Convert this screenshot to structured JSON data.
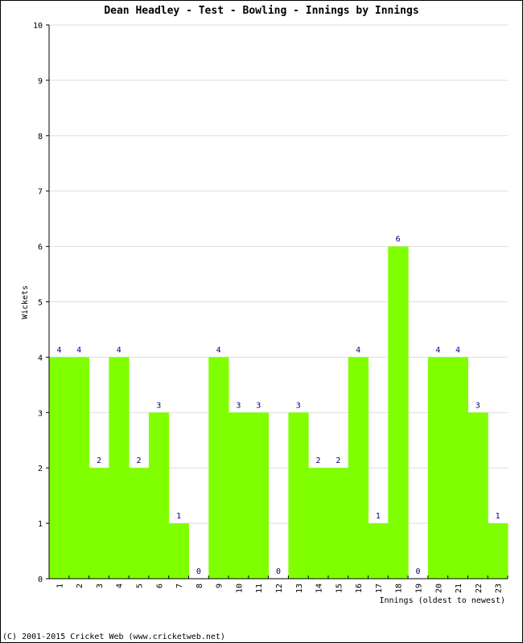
{
  "chart_data": {
    "type": "bar",
    "title": "Dean Headley - Test - Bowling - Innings by Innings",
    "xlabel": "Innings (oldest to newest)",
    "ylabel": "Wickets",
    "ylim": [
      0,
      10
    ],
    "yticks": [
      0,
      1,
      2,
      3,
      4,
      5,
      6,
      7,
      8,
      9,
      10
    ],
    "grid": true,
    "categories": [
      "1",
      "2",
      "3",
      "4",
      "5",
      "6",
      "7",
      "8",
      "9",
      "10",
      "11",
      "12",
      "13",
      "14",
      "15",
      "16",
      "17",
      "18",
      "19",
      "20",
      "21",
      "22",
      "23"
    ],
    "values": [
      4,
      4,
      2,
      4,
      2,
      3,
      1,
      0,
      4,
      3,
      3,
      0,
      3,
      2,
      2,
      4,
      1,
      6,
      0,
      4,
      4,
      3,
      1
    ],
    "bar_color": "#80ff00",
    "label_color": "#000080",
    "grid_color": "#dddddd"
  },
  "footer": {
    "copyright": "(C) 2001-2015 Cricket Web (www.cricketweb.net)"
  }
}
